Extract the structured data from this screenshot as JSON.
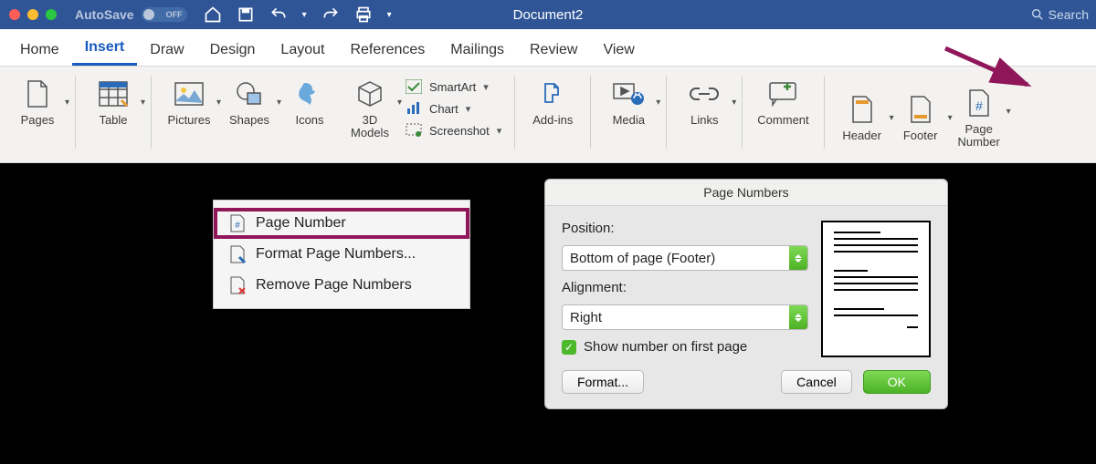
{
  "titlebar": {
    "autosave_label": "AutoSave",
    "autosave_state": "OFF",
    "doc_title": "Document2",
    "search_label": "Search",
    "traffic_colors": [
      "#ff5f57",
      "#febc2e",
      "#28c840"
    ]
  },
  "tabs": [
    {
      "label": "Home"
    },
    {
      "label": "Insert",
      "active": true
    },
    {
      "label": "Draw"
    },
    {
      "label": "Design"
    },
    {
      "label": "Layout"
    },
    {
      "label": "References"
    },
    {
      "label": "Mailings"
    },
    {
      "label": "Review"
    },
    {
      "label": "View"
    }
  ],
  "ribbon": {
    "pages": "Pages",
    "table": "Table",
    "pictures": "Pictures",
    "shapes": "Shapes",
    "icons": "Icons",
    "models": "3D\nModels",
    "smartart": "SmartArt",
    "chart": "Chart",
    "screenshot": "Screenshot",
    "addins": "Add-ins",
    "media": "Media",
    "links": "Links",
    "comment": "Comment",
    "header": "Header",
    "footer": "Footer",
    "pagenum": "Page\nNumber"
  },
  "menu": {
    "page_number": "Page Number",
    "format": "Format Page Numbers...",
    "remove": "Remove Page Numbers"
  },
  "dialog": {
    "title": "Page Numbers",
    "position_label": "Position:",
    "position_value": "Bottom of page (Footer)",
    "align_label": "Alignment:",
    "align_value": "Right",
    "checkbox": "Show number on first page",
    "format_btn": "Format...",
    "cancel": "Cancel",
    "ok": "OK"
  }
}
